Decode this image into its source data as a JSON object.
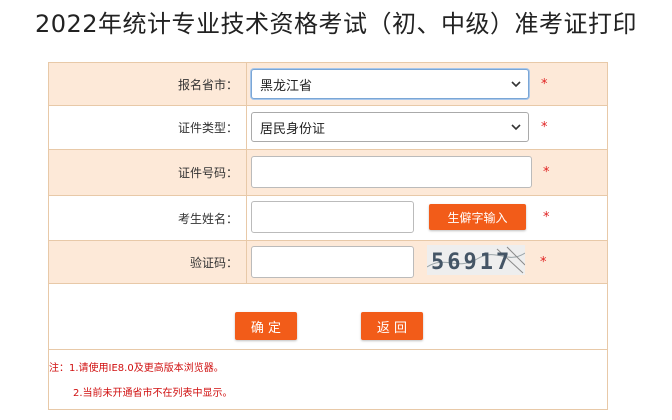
{
  "page": {
    "title": "2022年统计专业技术资格考试（初、中级）准考证打印"
  },
  "form": {
    "province": {
      "label": "报名省市：",
      "value": "黑龙江省"
    },
    "id_type": {
      "label": "证件类型：",
      "value": "居民身份证"
    },
    "id_number": {
      "label": "证件号码：",
      "value": ""
    },
    "name": {
      "label": "考生姓名：",
      "value": "",
      "rare_char_button": "生僻字输入"
    },
    "captcha": {
      "label": "验证码：",
      "value": "",
      "code": "56917"
    },
    "required_mark": "*"
  },
  "actions": {
    "confirm": "确 定",
    "back": "返 回"
  },
  "notes": {
    "line1": "注：1.请使用IE8.0及更高版本浏览器。",
    "line2": "2.当前未开通省市不在列表中显示。"
  },
  "colors": {
    "accent": "#f25c19",
    "row_shade": "#fde9d8",
    "border": "#e8c9a8",
    "required": "#e02020"
  }
}
